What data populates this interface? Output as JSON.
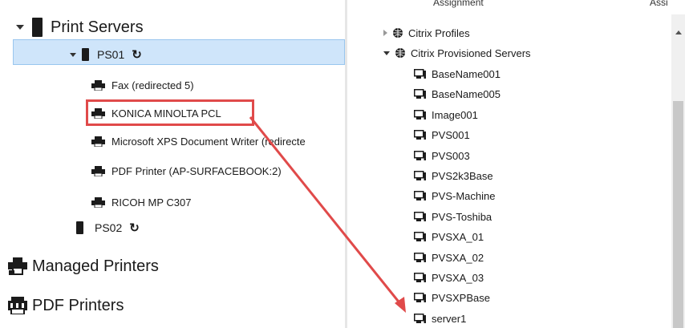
{
  "left_tree": {
    "print_servers": {
      "label": "Print Servers"
    },
    "ps01": {
      "label": "PS01"
    },
    "printers": [
      {
        "label": "Fax (redirected 5)"
      },
      {
        "label": "KONICA MINOLTA PCL"
      },
      {
        "label": "Microsoft XPS Document Writer (redirecte"
      },
      {
        "label": "PDF Printer (AP-SURFACEBOOK:2)"
      },
      {
        "label": "RICOH MP C307"
      }
    ],
    "ps02": {
      "label": "PS02"
    },
    "managed_printers": {
      "label": "Managed Printers"
    },
    "pdf_printers": {
      "label": "PDF Printers"
    }
  },
  "right_tree": {
    "header": {
      "col1": "Assignment",
      "col2": "Assi"
    },
    "citrix_profiles": {
      "label": "Citrix Profiles"
    },
    "citrix_provisioned": {
      "label": "Citrix Provisioned Servers"
    },
    "computers": [
      {
        "label": "BaseName001"
      },
      {
        "label": "BaseName005"
      },
      {
        "label": "Image001"
      },
      {
        "label": "PVS001"
      },
      {
        "label": "PVS003"
      },
      {
        "label": "PVS2k3Base"
      },
      {
        "label": "PVS-Machine"
      },
      {
        "label": "PVS-Toshiba"
      },
      {
        "label": "PVSXA_01"
      },
      {
        "label": "PVSXA_02"
      },
      {
        "label": "PVSXA_03"
      },
      {
        "label": "PVSXPBase"
      },
      {
        "label": "server1"
      }
    ]
  },
  "colors": {
    "highlight": "#e04a4a",
    "selection": "#cfe5fa"
  }
}
